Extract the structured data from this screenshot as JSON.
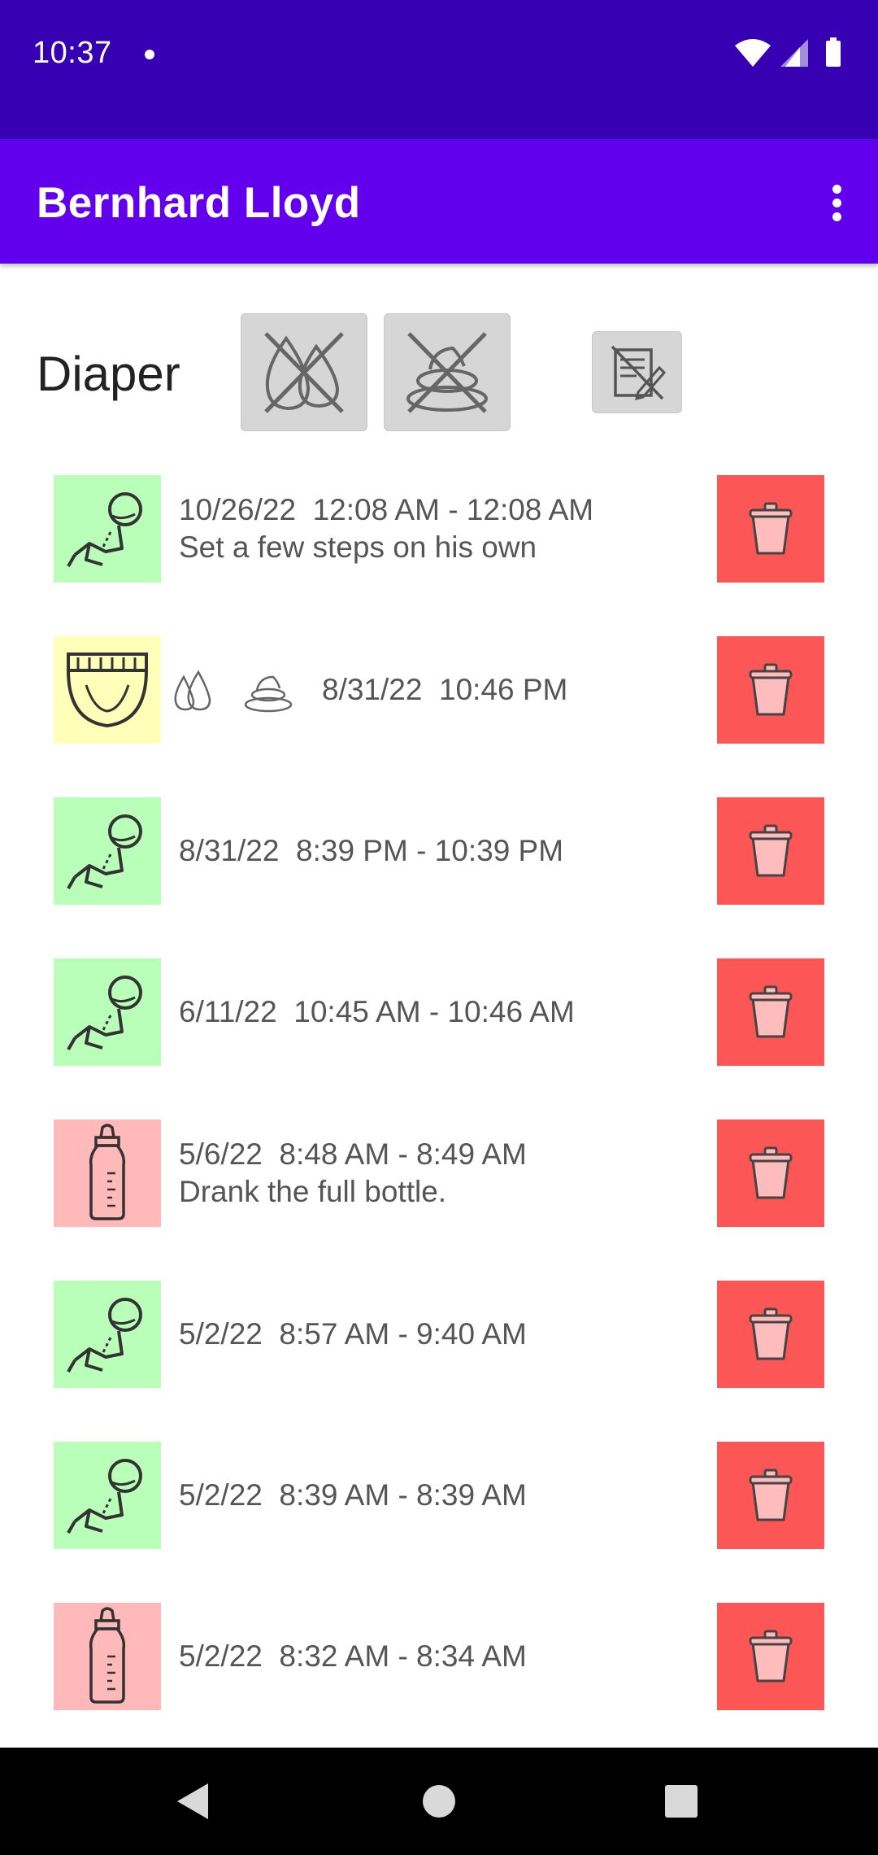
{
  "status_bar": {
    "time": "10:37"
  },
  "app_bar": {
    "title": "Bernhard Lloyd"
  },
  "filter": {
    "label": "Diaper"
  },
  "entries": [
    {
      "type": "crawling",
      "color": "#b9ffb9",
      "line1": "10/26/22  12:08 AM - 12:08 AM",
      "line2": "Set a few steps on his own"
    },
    {
      "type": "diaper",
      "color": "#ffffb9",
      "line1": "8/31/22  10:46 PM",
      "flags": [
        "wet-icon",
        "poop-icon"
      ]
    },
    {
      "type": "crawling",
      "color": "#b9ffb9",
      "line1": "8/31/22  8:39 PM - 10:39 PM"
    },
    {
      "type": "crawling",
      "color": "#b9ffb9",
      "line1": "6/11/22  10:45 AM - 10:46 AM"
    },
    {
      "type": "bottle",
      "color": "#ffb9b9",
      "line1": "5/6/22  8:48 AM - 8:49 AM",
      "line2": "Drank the full bottle."
    },
    {
      "type": "crawling",
      "color": "#b9ffb9",
      "line1": "5/2/22  8:57 AM - 9:40 AM"
    },
    {
      "type": "crawling",
      "color": "#b9ffb9",
      "line1": "5/2/22  8:39 AM - 8:39 AM"
    },
    {
      "type": "bottle",
      "color": "#ffb9b9",
      "line1": "5/2/22  8:32 AM - 8:34 AM"
    }
  ],
  "colors": {
    "status_bar": "#3700b3",
    "app_bar": "#6200ee",
    "delete": "#fd5656"
  },
  "icons": {
    "filter_wet": "wet-crossed-icon",
    "filter_poop": "poop-crossed-icon",
    "filter_notes": "notes-edit-icon",
    "delete": "trash-icon"
  }
}
